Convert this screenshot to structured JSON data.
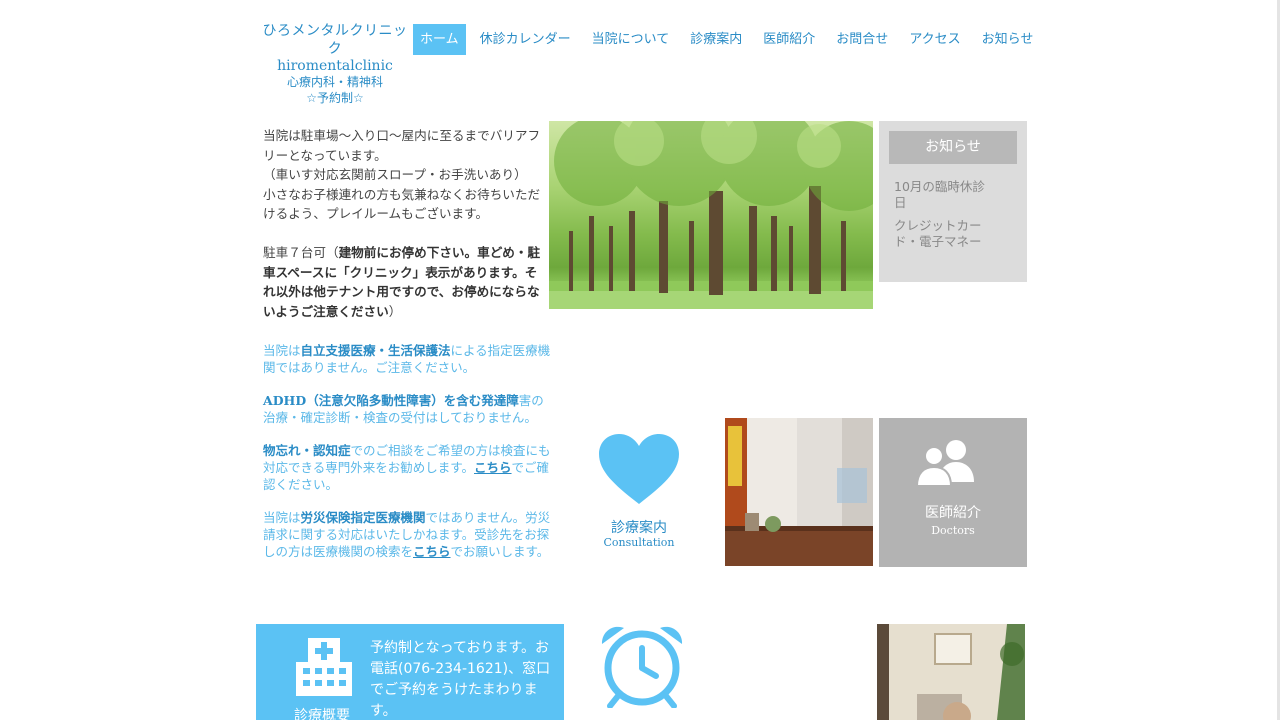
{
  "header": {
    "logo_line1": "ひろメンタルクリニック",
    "logo_line2": "hiromentalclinic",
    "logo_line3": "心療内科・精神科",
    "logo_line4": "☆予約制☆"
  },
  "nav": {
    "items": [
      "ホーム",
      "休診カレンダー",
      "当院について",
      "診療案内",
      "医師紹介",
      "お問合せ",
      "アクセス",
      "お知らせ"
    ],
    "active": "ホーム"
  },
  "intro": {
    "p1": "当院は駐車場〜入り口〜屋内に至るまでバリアフリーとなっています。",
    "p2": "（車いす対応玄関前スロープ・お手洗いあり）",
    "p3": "小さなお子様連れの方も気兼ねなくお待ちいただけるよう、プレイルームもございます。",
    "p4_plain": "駐車７台可（",
    "p4_bold": "建物前にお停め下さい。車どめ・駐車スペースに「クリニック」表示があります。それ以外は他テナント用ですので、お停めにならないようご注意ください",
    "p4_end": "）"
  },
  "notes": {
    "n1_pre": "当院は",
    "n1_bold": "自立支援医療・生活保護法",
    "n1_post": "による指定医療機関ではありません。ご注意ください。",
    "n2_bold": "ADHD（注意欠陥多動性障害）を含む発達障",
    "n2_post": "害の治療・確定診断・検査の受付はしておりません。",
    "n3_bold": "物忘れ・認知症",
    "n3_post": "でのご相談をご希望の方は検査にも対応できる専門外来をお勧めします。",
    "n3_link": "こちら",
    "n3_end": "でご確認ください。",
    "n4_pre": "当院は",
    "n4_bold": "労災保険指定医療機関",
    "n4_post": "ではありません。労災請求に関する対応はいたしかねます。受診先をお探しの方は医療機関の検索を",
    "n4_link": "こちら",
    "n4_end": "でお願いします。"
  },
  "news": {
    "button": "お知らせ",
    "items": [
      "10月の臨時休診日",
      "クレジットカード・電子マネー"
    ]
  },
  "tiles": {
    "consult_jp": "診療案内",
    "consult_en": "Consultation",
    "doctors_jp": "医師紹介",
    "doctors_en": "Doctors",
    "overview_label": "診療概要",
    "overview_text": "予約制となっております。お電話(076-234-1621)、窓口でご予約をうけたまわります。"
  },
  "colors": {
    "accent": "#5bc2f4",
    "link": "#2a8cc6",
    "tile_gray": "#b3b3b3",
    "news_bg": "#dcdcdc"
  },
  "icons": [
    "heart-icon",
    "users-icon",
    "hospital-icon",
    "alarm-clock-icon"
  ]
}
